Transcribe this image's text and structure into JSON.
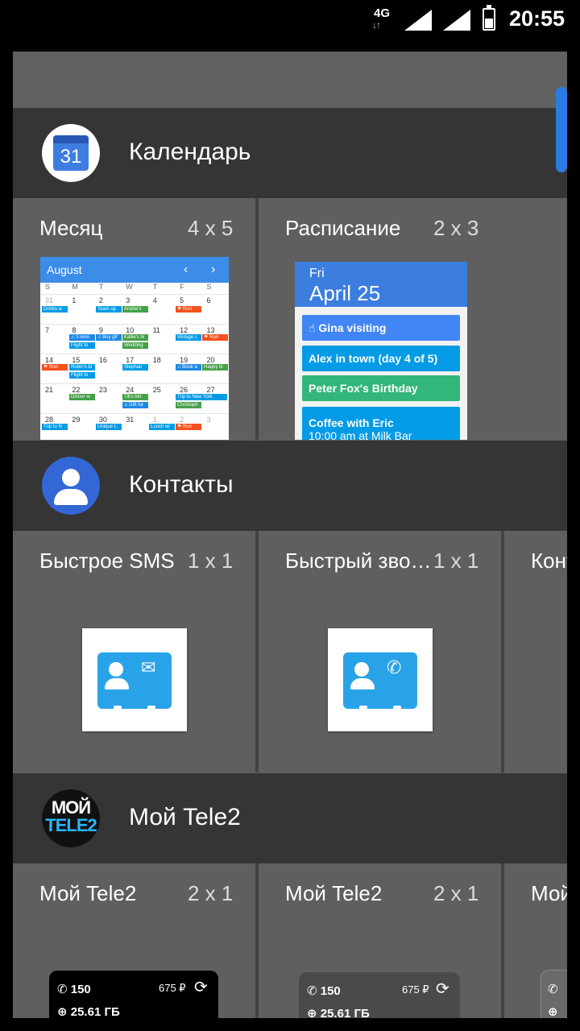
{
  "status_bar": {
    "network": "4G",
    "arrows": "↓↑",
    "time": "20:55"
  },
  "sections": [
    {
      "app_name": "Календарь",
      "icon_text": "31"
    },
    {
      "app_name": "Контакты"
    },
    {
      "app_name": "Мой Tele2",
      "icon_text_1": "МОЙ",
      "icon_text_2": "TELE2"
    }
  ],
  "calendar_widgets": [
    {
      "label": "Месяц",
      "size": "4 x 5"
    },
    {
      "label": "Расписание",
      "size": "2 x 3"
    }
  ],
  "month_preview": {
    "month": "August",
    "prev": "‹",
    "next": "›",
    "dow": [
      "S",
      "M",
      "T",
      "W",
      "T",
      "F",
      "S"
    ],
    "weeks": [
      [
        "31",
        "1",
        "2",
        "3",
        "4",
        "5",
        "6"
      ],
      [
        "7",
        "8",
        "9",
        "10",
        "11",
        "12",
        "13"
      ],
      [
        "14",
        "15",
        "16",
        "17",
        "18",
        "19",
        "20"
      ],
      [
        "21",
        "22",
        "23",
        "24",
        "25",
        "26",
        "27"
      ],
      [
        "28",
        "29",
        "30",
        "31",
        "1",
        "2",
        "3"
      ]
    ],
    "events": {
      "e1": "Drinks w",
      "e2": "Team up",
      "e3": "Andrei's",
      "e4": "⚑ Run",
      "e5": "♫ 3 remi",
      "e6": "♫ Buy gif",
      "e7": "Kallie's bi",
      "e8": "Vintage c",
      "e9": "⚑ Run",
      "e10": "Flight to",
      "e11": "Wedding",
      "e12": "⚑ Run",
      "e13": "Robin's bi",
      "e14": "Stephan",
      "e15": "♫ Book a",
      "e16": "Happy bi",
      "e17": "Flight to",
      "e18": "Dinner w",
      "e19": "Till's birt",
      "e20": "Trip to New York",
      "e21": "♫ Gift for",
      "e22": "Christoph",
      "e23": "Trip to N",
      "e24": "Unique L",
      "e25": "Lunch wi",
      "e26": "⚑ Run"
    }
  },
  "schedule_preview": {
    "day": "Fri",
    "date": "April 25",
    "items": [
      {
        "text": "☝ Gina visiting",
        "color": "#4285f4"
      },
      {
        "text": "Alex in town (day 4 of 5)",
        "color": "#039be5"
      },
      {
        "text": "Peter Fox's Birthday",
        "color": "#33b679"
      },
      {
        "text": "Coffee with Eric",
        "text2": "10:00 am at Milk Bar",
        "color": "#039be5"
      }
    ]
  },
  "contacts_widgets": [
    {
      "label": "Быстрое SMS",
      "size": "1 x 1",
      "glyph": "✉"
    },
    {
      "label": "Быстрый зво…",
      "size": "1 x 1",
      "glyph": "✆"
    },
    {
      "label": "Конт"
    }
  ],
  "tele2_widgets": [
    {
      "label": "Мой Tele2",
      "size": "2 x 1",
      "minutes": "150",
      "balance": "675 ₽",
      "data": "25.61 ГБ"
    },
    {
      "label": "Мой Tele2",
      "size": "2 x 1",
      "minutes": "150",
      "balance": "675 ₽",
      "data": "25.61 ГБ"
    },
    {
      "label": "Мой"
    }
  ],
  "icons": {
    "phone": "✆",
    "globe": "⊕",
    "refresh": "⟳"
  },
  "colors": {
    "accent_blue": "#2a7be4",
    "header_bg": "#353535",
    "panel_bg": "#616161"
  }
}
